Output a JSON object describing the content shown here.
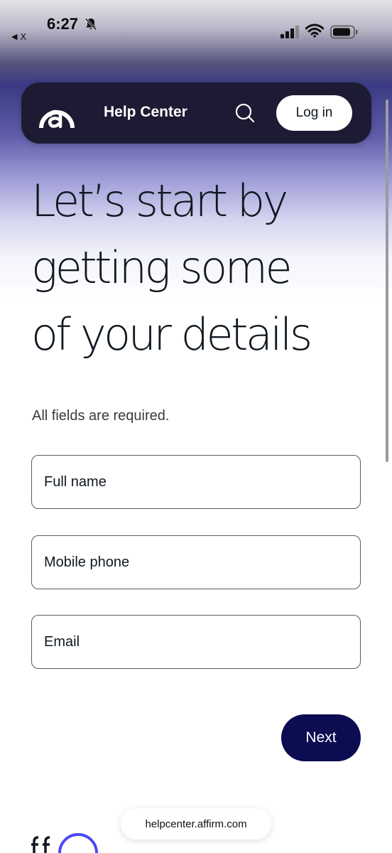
{
  "status_bar": {
    "time": "6:27",
    "back_app": "X",
    "icons": [
      "bell-slash-icon",
      "signal-icon",
      "wifi-icon",
      "battery-icon"
    ]
  },
  "nav": {
    "logo": "affirm-logo-icon",
    "title": "Help Center",
    "search_icon": "search-icon",
    "login_label": "Log in"
  },
  "headline": {
    "line1": "Let’s start by",
    "line2": "getting some",
    "line3": "of your details"
  },
  "form": {
    "required_note": "All fields are required.",
    "full_name": {
      "placeholder": "Full name",
      "value": ""
    },
    "mobile_phone": {
      "placeholder": "Mobile phone",
      "value": ""
    },
    "email": {
      "placeholder": "Email",
      "value": ""
    },
    "next_label": "Next"
  },
  "browser": {
    "url": "helpcenter.affirm.com"
  },
  "colors": {
    "nav_bg": "#1d1b33",
    "accent": "#0c0c52",
    "gradient_mid": "#3b3a84"
  }
}
